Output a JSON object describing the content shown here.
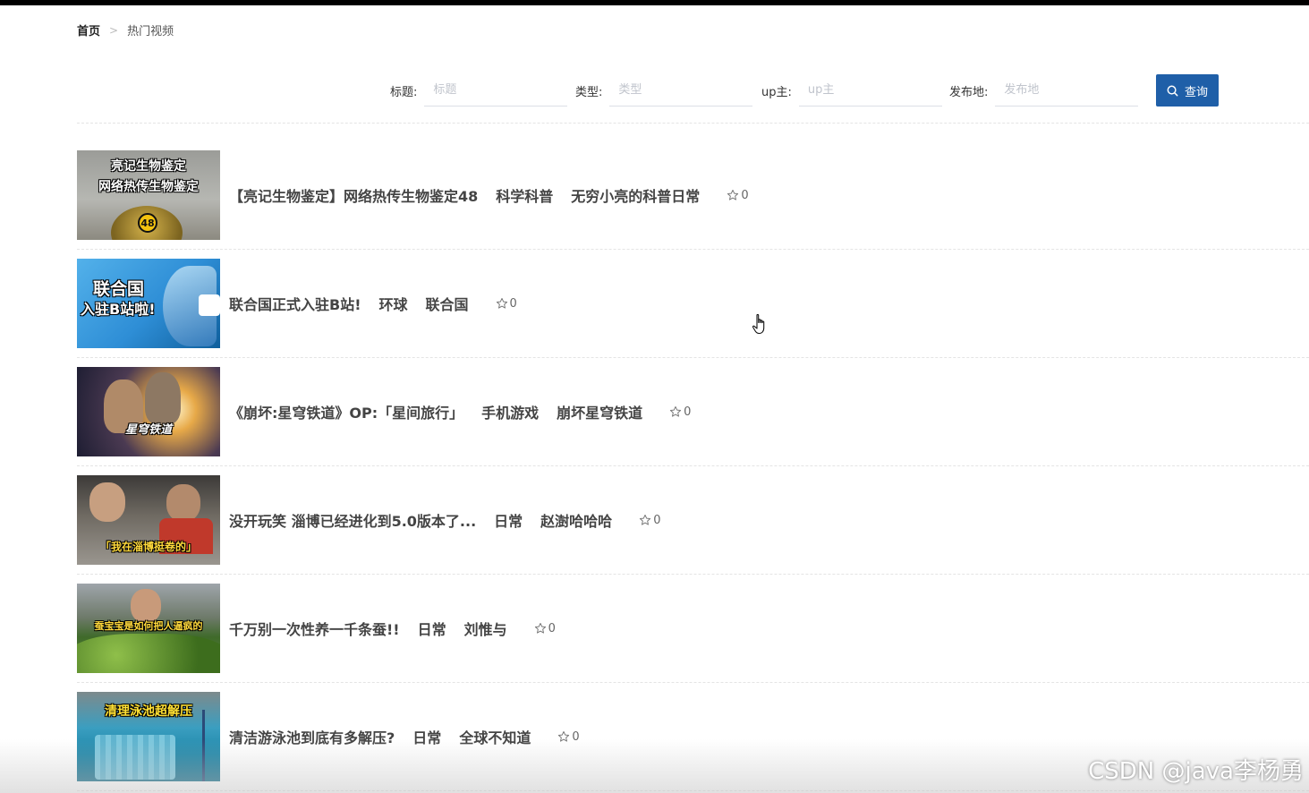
{
  "breadcrumb": {
    "home": "首页",
    "separator": ">",
    "current": "热门视频"
  },
  "filters": {
    "title": {
      "label": "标题:",
      "placeholder": "标题"
    },
    "type": {
      "label": "类型:",
      "placeholder": "类型"
    },
    "up": {
      "label": "up主:",
      "placeholder": "up主"
    },
    "place": {
      "label": "发布地:",
      "placeholder": "发布地"
    }
  },
  "search_button": {
    "label": "查询",
    "color": "#1f5fa8",
    "icon": "search-icon"
  },
  "videos": [
    {
      "title": "【亮记生物鉴定】网络热传生物鉴定48",
      "category": "科学科普",
      "uploader": "无穷小亮的科普日常",
      "favorites": "0",
      "thumb_caption": [
        "亮记生物鉴定",
        "网络热传生物鉴定"
      ],
      "thumb_badge": "48"
    },
    {
      "title": "联合国正式入驻B站!",
      "category": "环球",
      "uploader": "联合国",
      "favorites": "0",
      "thumb_caption": [
        "联合国",
        "入驻B站啦!"
      ]
    },
    {
      "title": "《崩坏:星穹铁道》OP:「星间旅行」",
      "category": "手机游戏",
      "uploader": "崩坏星穹铁道",
      "favorites": "0",
      "thumb_caption": [
        "星穹铁道"
      ]
    },
    {
      "title": "没开玩笑 淄博已经进化到5.0版本了...",
      "category": "日常",
      "uploader": "赵澍哈哈哈",
      "favorites": "0",
      "thumb_caption": [
        "「我在淄博挺卷的」"
      ]
    },
    {
      "title": "千万别一次性养一千条蚕!!",
      "category": "日常",
      "uploader": "刘惟与",
      "favorites": "0",
      "thumb_caption": [
        "蚕宝宝是如何把人逼疯的"
      ]
    },
    {
      "title": "清洁游泳池到底有多解压?",
      "category": "日常",
      "uploader": "全球不知道",
      "favorites": "0",
      "thumb_caption": [
        "清理泳池超解压"
      ]
    }
  ],
  "watermark": "CSDN @java李杨勇"
}
